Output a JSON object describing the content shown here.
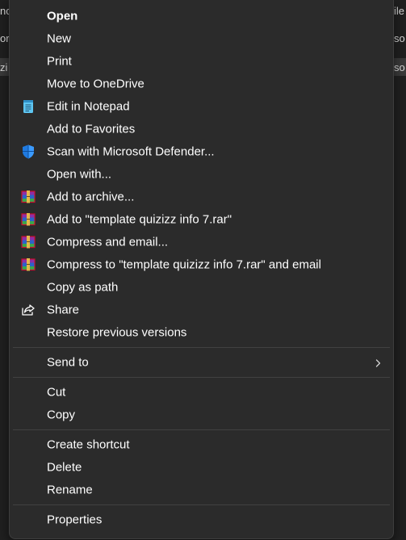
{
  "background": {
    "left_fragments": [
      "nc",
      "or",
      "zi"
    ],
    "right_fragments": [
      "ile",
      "so",
      "so"
    ]
  },
  "menu": {
    "items": [
      {
        "label": "Open",
        "icon": "none",
        "bold": true
      },
      {
        "label": "New",
        "icon": "none"
      },
      {
        "label": "Print",
        "icon": "none"
      },
      {
        "label": "Move to OneDrive",
        "icon": "none"
      },
      {
        "label": "Edit in Notepad",
        "icon": "notepad-icon"
      },
      {
        "label": "Add to Favorites",
        "icon": "none"
      },
      {
        "label": "Scan with Microsoft Defender...",
        "icon": "defender-shield-icon"
      },
      {
        "label": "Open with...",
        "icon": "none"
      },
      {
        "label": "Add to archive...",
        "icon": "winrar-icon"
      },
      {
        "label": "Add to \"template quizizz info 7.rar\"",
        "icon": "winrar-icon"
      },
      {
        "label": "Compress and email...",
        "icon": "winrar-icon"
      },
      {
        "label": "Compress to \"template quizizz info 7.rar\" and email",
        "icon": "winrar-icon"
      },
      {
        "label": "Copy as path",
        "icon": "none"
      },
      {
        "label": "Share",
        "icon": "share-icon"
      },
      {
        "label": "Restore previous versions",
        "icon": "none"
      }
    ],
    "send_to": {
      "label": "Send to",
      "icon": "chevron-right-icon"
    },
    "group3": [
      {
        "label": "Cut"
      },
      {
        "label": "Copy"
      }
    ],
    "group4": [
      {
        "label": "Create shortcut"
      },
      {
        "label": "Delete"
      },
      {
        "label": "Rename"
      }
    ],
    "properties": {
      "label": "Properties"
    }
  },
  "colors": {
    "menu_bg": "#2b2b2b",
    "text": "#ffffff",
    "separator": "#414141",
    "defender_blue": "#1f7ae0",
    "notepad_blue": "#5ec6f2"
  }
}
